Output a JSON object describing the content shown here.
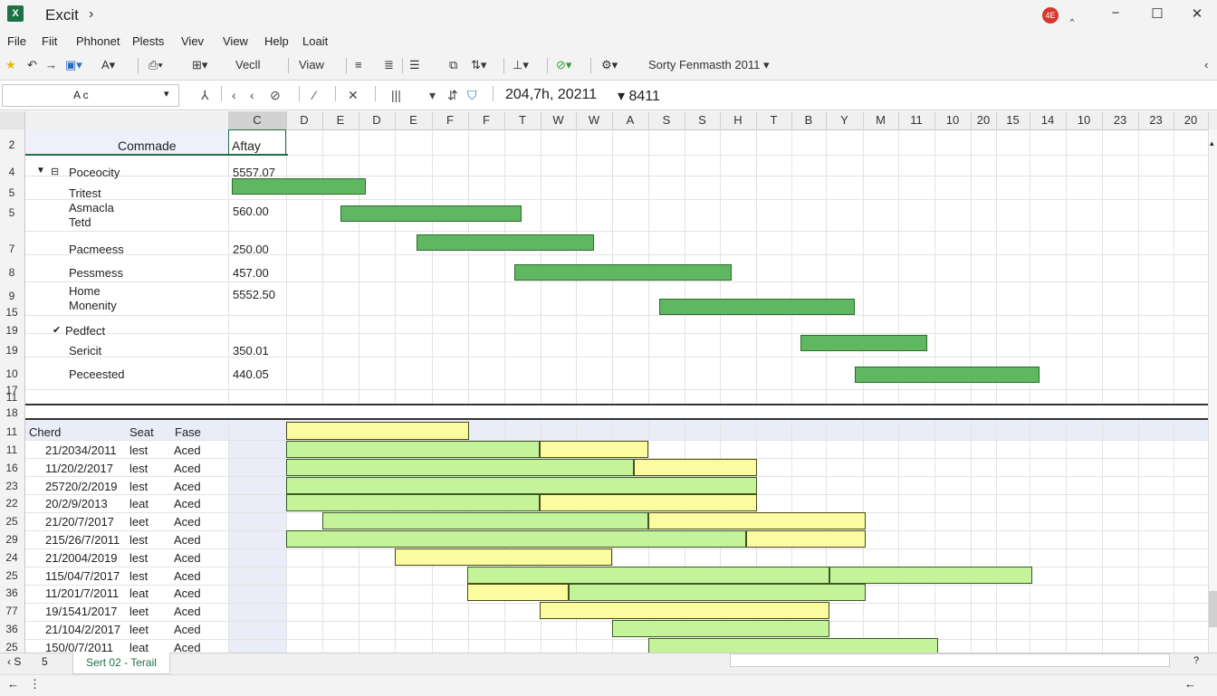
{
  "window": {
    "app_title": "Excit",
    "title_chevron": "›",
    "avatar": "4E",
    "minimize": "‸",
    "restore": "−",
    "maximize": "☐",
    "close": "✕"
  },
  "menu": [
    "File",
    "Fiit",
    "Phhonet",
    "Plests",
    "Viev",
    "View",
    "Help",
    "Loait"
  ],
  "toolbar": {
    "font_label": "Vecll",
    "view_label": "Viaw",
    "sort_label": "Sorty Fenmasth 2011"
  },
  "formula_bar": {
    "namebox_value": "A c",
    "formula_value": "204,7h, 20211",
    "extra_value": "8411"
  },
  "columns": [
    "C",
    "D",
    "E",
    "D",
    "E",
    "F",
    "F",
    "T",
    "W",
    "W",
    "A",
    "S",
    "S",
    "H",
    "T",
    "B",
    "Y",
    "M",
    "11",
    "10",
    "20",
    "15",
    "14",
    "10",
    "23",
    "23",
    "20"
  ],
  "section1": {
    "header": {
      "row": "2",
      "col_b": "Commade",
      "col_c": "Aftay"
    },
    "rows": [
      {
        "rownum": "4",
        "label": "Poceocity",
        "value": "5557.07",
        "group": true
      },
      {
        "rownum": "5",
        "label": "Tritest",
        "value": ""
      },
      {
        "rownum": "5",
        "label": "Asmacla",
        "label2": "Tetd",
        "value": "560.00"
      },
      {
        "rownum": "7",
        "label": "Pacmeess",
        "value": "250.00"
      },
      {
        "rownum": "8",
        "label": "Pessmess",
        "value": "457.00"
      },
      {
        "rownum": "9",
        "rownum2": "15",
        "label": "Home",
        "label2": "Monenity",
        "value": "5552.50"
      },
      {
        "rownum": "19",
        "label": "Pedfect",
        "value": "",
        "group": true
      },
      {
        "rownum": "19",
        "label": "Sericit",
        "value": "350.01"
      },
      {
        "rownum": "10",
        "rownum2": "17",
        "label": "Peceested",
        "value": "440.05"
      }
    ],
    "extra_rows": [
      "11",
      "18"
    ],
    "bars": [
      {
        "start": 0,
        "end": 3.7
      },
      {
        "start": 1.5,
        "end": 6.5
      },
      {
        "start": 3.6,
        "end": 8.5
      },
      {
        "start": 6.3,
        "end": 12.3
      },
      {
        "start": 10.3,
        "end": 15.7
      },
      {
        "start": 14.2,
        "end": 17.7
      },
      {
        "start": 15.7,
        "end": 20.8
      }
    ]
  },
  "section2": {
    "header": {
      "rownum": "11",
      "col_a": "Cherd",
      "col_b": "Seat",
      "col_c": "Fase"
    },
    "rows": [
      {
        "rownum": "11",
        "date": "21/2034/2011",
        "seat": "lest",
        "fase": "Aced"
      },
      {
        "rownum": "16",
        "date": "11/20/2/2017",
        "seat": "lest",
        "fase": "Aced"
      },
      {
        "rownum": "23",
        "date": "25720/2/2019",
        "seat": "lest",
        "fase": "Aced"
      },
      {
        "rownum": "22",
        "date": "20/2/9/2013",
        "seat": "leat",
        "fase": "Aced"
      },
      {
        "rownum": "25",
        "date": "21/20/7/2017",
        "seat": "leet",
        "fase": "Aced"
      },
      {
        "rownum": "29",
        "date": "215/26/7/2011",
        "seat": "lest",
        "fase": "Aced"
      },
      {
        "rownum": "24",
        "date": "21/2004/2019",
        "seat": "lest",
        "fase": "Aced"
      },
      {
        "rownum": "25",
        "date": "115/04/7/2017",
        "seat": "lest",
        "fase": "Aced"
      },
      {
        "rownum": "36",
        "date": "11/201/7/2011",
        "seat": "leat",
        "fase": "Aced"
      },
      {
        "rownum": "77",
        "date": "19/1541/2017",
        "seat": "leet",
        "fase": "Aced"
      },
      {
        "rownum": "36",
        "date": "21/104/2/2017",
        "seat": "leet",
        "fase": "Aced"
      },
      {
        "rownum": "25",
        "date": "150/0/7/2011",
        "seat": "leat",
        "fase": "Aced"
      }
    ],
    "header_bar": {
      "start": 0,
      "end": 5,
      "color": "yellow"
    },
    "bars": [
      [
        {
          "start": 0,
          "end": 7,
          "color": "lgreen"
        },
        {
          "start": 7,
          "end": 10,
          "color": "yellow"
        }
      ],
      [
        {
          "start": 0,
          "end": 9.6,
          "color": "lgreen"
        },
        {
          "start": 9.6,
          "end": 13,
          "color": "yellow"
        }
      ],
      [
        {
          "start": 0,
          "end": 13,
          "color": "lgreen"
        }
      ],
      [
        {
          "start": 0,
          "end": 7,
          "color": "lgreen"
        },
        {
          "start": 7,
          "end": 13,
          "color": "yellow"
        }
      ],
      [
        {
          "start": 1,
          "end": 10,
          "color": "lgreen"
        },
        {
          "start": 10,
          "end": 16,
          "color": "yellow"
        }
      ],
      [
        {
          "start": 0,
          "end": 12.7,
          "color": "lgreen"
        },
        {
          "start": 12.7,
          "end": 16,
          "color": "yellow"
        }
      ],
      [
        {
          "start": 3,
          "end": 9,
          "color": "yellow"
        }
      ],
      [
        {
          "start": 5,
          "end": 15,
          "color": "lgreen"
        },
        {
          "start": 15,
          "end": 20.6,
          "color": "lgreen"
        }
      ],
      [
        {
          "start": 5,
          "end": 7.8,
          "color": "yellow"
        },
        {
          "start": 7.8,
          "end": 16,
          "color": "lgreen"
        }
      ],
      [
        {
          "start": 7,
          "end": 15,
          "color": "yellow"
        }
      ],
      [
        {
          "start": 9,
          "end": 15,
          "color": "lgreen"
        }
      ],
      [
        {
          "start": 10,
          "end": 18,
          "color": "lgreen"
        }
      ]
    ]
  },
  "tabs": {
    "nav_left": "‹ S",
    "nav_count": "5",
    "active_sheet": "Sert 02 - Terail",
    "scroll_mark": "?"
  },
  "status": {
    "left": "←",
    "dots": "⋮",
    "right": "←"
  },
  "colors": {
    "bar_green": "#5fb761",
    "bar_light_green": "#c5f39a",
    "bar_yellow": "#fbfc9f",
    "brand": "#1e7145"
  }
}
